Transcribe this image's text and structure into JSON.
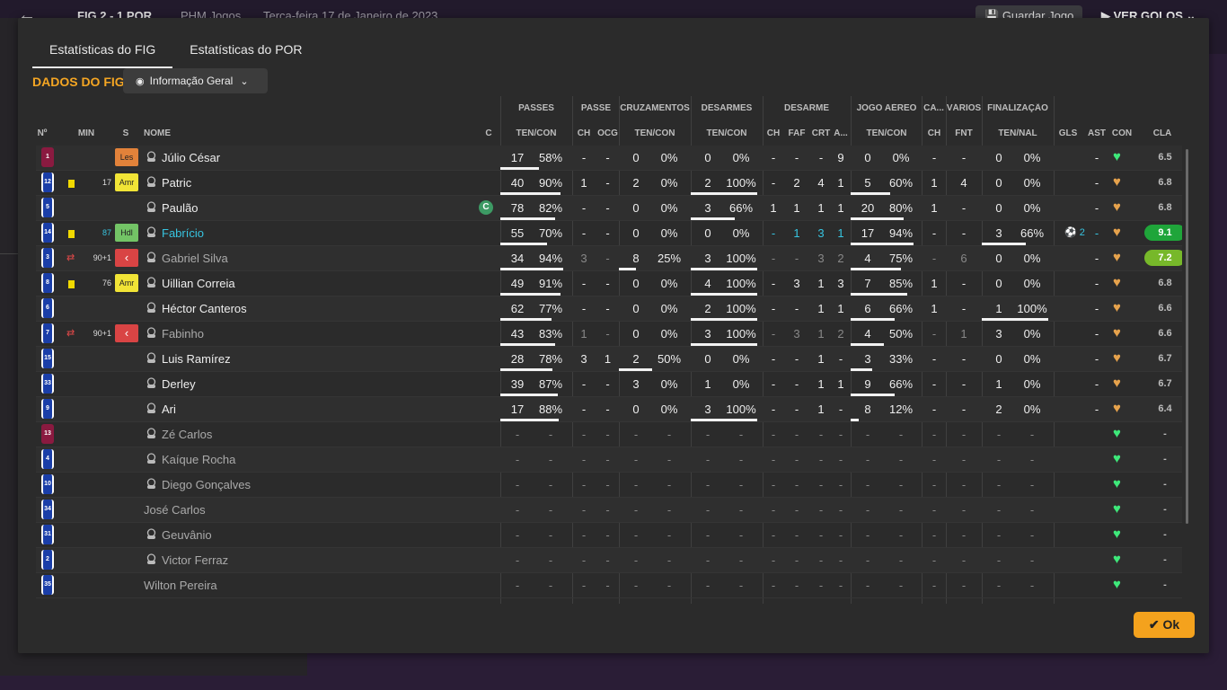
{
  "background": {
    "back_icon": "arrow-left-icon",
    "score": "FIG   2 - 1   POR",
    "venue": "PHM Jogos",
    "date": "Terça-feira 17 de Janeiro de 2023",
    "save_label": "Guardar Jogo",
    "goals_label": "VER GOLOS"
  },
  "tabs": [
    {
      "label": "Estatísticas do FIG",
      "active": true
    },
    {
      "label": "Estatísticas do POR",
      "active": false
    }
  ],
  "section_title": "DADOS DO FIG",
  "view_dropdown": {
    "label": "Informação Geral",
    "icon": "eye-icon"
  },
  "group_headers": [
    "PASSES",
    "PASSE",
    "CRUZAMENTOS",
    "DESARMES",
    "DESARME",
    "JOGO AÉREO",
    "CA...",
    "VÁRIOS",
    "FINALIZAÇÃO"
  ],
  "column_headers": [
    "Nº",
    "MIN",
    "S",
    "NOME",
    "C",
    "TEN/CON",
    "CH",
    "OCG",
    "TEN/CON",
    "TEN/CON",
    "CH",
    "FAF",
    "CRT",
    "A...",
    "TEN/CON",
    "CH",
    "FNT",
    "TEN/NAL",
    "GLS",
    "AST",
    "CON",
    "CLA"
  ],
  "colors": {
    "accent": "#f5a623",
    "cyan": "#37c4e0",
    "heart_green": "#3ee87a",
    "heart_orange": "#e6a24c",
    "rating_green": "#1fa53a",
    "rating_lime": "#77b82a"
  },
  "players": [
    {
      "num": "1",
      "kit": "gk",
      "card": false,
      "sub": false,
      "min": "",
      "min_cyan": false,
      "pos": "Les",
      "pos_type": "les",
      "icon": true,
      "name": "Júlio César",
      "name_style": "",
      "captain": false,
      "passes": [
        "17",
        "58%"
      ],
      "passes_pct": 58,
      "passe": [
        "-",
        "-"
      ],
      "cross": [
        "0",
        "0%"
      ],
      "cross_pct": 0,
      "tack": [
        "0",
        "0%"
      ],
      "tack_pct": 0,
      "des": [
        "-",
        "-",
        "-",
        "9"
      ],
      "air": [
        "0",
        "0%"
      ],
      "air_pct": 0,
      "ca": "-",
      "fnt": "-",
      "fin": [
        "0",
        "0%"
      ],
      "fin_pct": 0,
      "gls": "",
      "ast": "-",
      "heart": "g",
      "rating": "6.5",
      "rating_bg": "",
      "dim": false
    },
    {
      "num": "12",
      "kit": "bl",
      "card": true,
      "sub": false,
      "min": "17",
      "min_cyan": false,
      "pos": "Amr",
      "pos_type": "amr",
      "icon": true,
      "name": "Patric",
      "name_style": "",
      "captain": false,
      "passes": [
        "40",
        "90%"
      ],
      "passes_pct": 90,
      "passe": [
        "1",
        "-"
      ],
      "cross": [
        "2",
        "0%"
      ],
      "cross_pct": 0,
      "tack": [
        "2",
        "100%"
      ],
      "tack_pct": 100,
      "des": [
        "-",
        "2",
        "4",
        "1"
      ],
      "air": [
        "5",
        "60%"
      ],
      "air_pct": 60,
      "ca": "1",
      "fnt": "4",
      "fin": [
        "0",
        "0%"
      ],
      "fin_pct": 0,
      "gls": "",
      "ast": "-",
      "heart": "o",
      "rating": "6.8",
      "rating_bg": "",
      "dim": false
    },
    {
      "num": "5",
      "kit": "bl",
      "card": false,
      "sub": false,
      "min": "",
      "min_cyan": false,
      "pos": "",
      "pos_type": "",
      "icon": true,
      "name": "Paulão",
      "name_style": "",
      "captain": true,
      "passes": [
        "78",
        "82%"
      ],
      "passes_pct": 82,
      "passe": [
        "-",
        "-"
      ],
      "cross": [
        "0",
        "0%"
      ],
      "cross_pct": 0,
      "tack": [
        "3",
        "66%"
      ],
      "tack_pct": 66,
      "des": [
        "1",
        "1",
        "1",
        "1"
      ],
      "air": [
        "20",
        "80%"
      ],
      "air_pct": 80,
      "ca": "1",
      "fnt": "-",
      "fin": [
        "0",
        "0%"
      ],
      "fin_pct": 0,
      "gls": "",
      "ast": "-",
      "heart": "o",
      "rating": "6.8",
      "rating_bg": "",
      "dim": false
    },
    {
      "num": "14",
      "kit": "bl",
      "card": true,
      "sub": false,
      "min": "87",
      "min_cyan": true,
      "pos": "Hdl",
      "pos_type": "hdl",
      "icon": true,
      "name": "Fabrício",
      "name_style": "cy",
      "captain": false,
      "passes": [
        "55",
        "70%"
      ],
      "passes_pct": 70,
      "passe": [
        "-",
        "-"
      ],
      "cross": [
        "0",
        "0%"
      ],
      "cross_pct": 0,
      "tack": [
        "0",
        "0%"
      ],
      "tack_pct": 0,
      "des": [
        "-",
        "1",
        "3",
        "1"
      ],
      "des_cyan": true,
      "air": [
        "17",
        "94%"
      ],
      "air_pct": 94,
      "ca": "-",
      "fnt": "-",
      "fin": [
        "3",
        "66%"
      ],
      "fin_pct": 66,
      "gls": "2",
      "ast": "-",
      "heart": "o",
      "rating": "9.1",
      "rating_bg": "green",
      "dim": false
    },
    {
      "num": "3",
      "kit": "bl",
      "card": false,
      "sub": true,
      "min": "90+1",
      "min_cyan": false,
      "pos": "‹",
      "pos_type": "sub",
      "icon": true,
      "name": "Gabriel Silva",
      "name_style": "dim",
      "captain": false,
      "passes": [
        "34",
        "94%"
      ],
      "passes_pct": 94,
      "passe": [
        "3",
        "-"
      ],
      "cross": [
        "8",
        "25%"
      ],
      "cross_pct": 25,
      "tack": [
        "3",
        "100%"
      ],
      "tack_pct": 100,
      "des": [
        "-",
        "-",
        "3",
        "2"
      ],
      "air": [
        "4",
        "75%"
      ],
      "air_pct": 75,
      "ca": "-",
      "fnt": "6",
      "fin": [
        "0",
        "0%"
      ],
      "fin_pct": 0,
      "gls": "",
      "ast": "-",
      "heart": "o",
      "rating": "7.2",
      "rating_bg": "lime",
      "dim": true
    },
    {
      "num": "8",
      "kit": "bl",
      "card": true,
      "sub": false,
      "min": "76",
      "min_cyan": false,
      "pos": "Amr",
      "pos_type": "amr",
      "icon": true,
      "name": "Uillian Correia",
      "name_style": "",
      "captain": false,
      "passes": [
        "49",
        "91%"
      ],
      "passes_pct": 91,
      "passe": [
        "-",
        "-"
      ],
      "cross": [
        "0",
        "0%"
      ],
      "cross_pct": 0,
      "tack": [
        "4",
        "100%"
      ],
      "tack_pct": 100,
      "des": [
        "-",
        "3",
        "1",
        "3"
      ],
      "air": [
        "7",
        "85%"
      ],
      "air_pct": 85,
      "ca": "1",
      "fnt": "-",
      "fin": [
        "0",
        "0%"
      ],
      "fin_pct": 0,
      "gls": "",
      "ast": "-",
      "heart": "o",
      "rating": "6.8",
      "rating_bg": "",
      "dim": false
    },
    {
      "num": "6",
      "kit": "bl",
      "card": false,
      "sub": false,
      "min": "",
      "min_cyan": false,
      "pos": "",
      "pos_type": "",
      "icon": true,
      "name": "Héctor Canteros",
      "name_style": "",
      "captain": false,
      "passes": [
        "62",
        "77%"
      ],
      "passes_pct": 77,
      "passe": [
        "-",
        "-"
      ],
      "cross": [
        "0",
        "0%"
      ],
      "cross_pct": 0,
      "tack": [
        "2",
        "100%"
      ],
      "tack_pct": 100,
      "des": [
        "-",
        "-",
        "1",
        "1"
      ],
      "air": [
        "6",
        "66%"
      ],
      "air_pct": 66,
      "ca": "1",
      "fnt": "-",
      "fin": [
        "1",
        "100%"
      ],
      "fin_pct": 100,
      "gls": "",
      "ast": "-",
      "heart": "o",
      "rating": "6.6",
      "rating_bg": "",
      "dim": false
    },
    {
      "num": "7",
      "kit": "bl",
      "card": false,
      "sub": true,
      "min": "90+1",
      "min_cyan": false,
      "pos": "‹",
      "pos_type": "sub",
      "icon": true,
      "name": "Fabinho",
      "name_style": "dim",
      "captain": false,
      "passes": [
        "43",
        "83%"
      ],
      "passes_pct": 83,
      "passe": [
        "1",
        "-"
      ],
      "cross": [
        "0",
        "0%"
      ],
      "cross_pct": 0,
      "tack": [
        "3",
        "100%"
      ],
      "tack_pct": 100,
      "des": [
        "-",
        "3",
        "1",
        "2"
      ],
      "air": [
        "4",
        "50%"
      ],
      "air_pct": 50,
      "ca": "-",
      "fnt": "1",
      "fin": [
        "3",
        "0%"
      ],
      "fin_pct": 0,
      "gls": "",
      "ast": "-",
      "heart": "o",
      "rating": "6.6",
      "rating_bg": "",
      "dim": true
    },
    {
      "num": "15",
      "kit": "bl",
      "card": false,
      "sub": false,
      "min": "",
      "min_cyan": false,
      "pos": "",
      "pos_type": "",
      "icon": true,
      "name": "Luis Ramírez",
      "name_style": "",
      "captain": false,
      "passes": [
        "28",
        "78%"
      ],
      "passes_pct": 78,
      "passe": [
        "3",
        "1"
      ],
      "cross": [
        "2",
        "50%"
      ],
      "cross_pct": 50,
      "tack": [
        "0",
        "0%"
      ],
      "tack_pct": 0,
      "des": [
        "-",
        "-",
        "1",
        "-"
      ],
      "air": [
        "3",
        "33%"
      ],
      "air_pct": 33,
      "ca": "-",
      "fnt": "-",
      "fin": [
        "0",
        "0%"
      ],
      "fin_pct": 0,
      "gls": "",
      "ast": "-",
      "heart": "o",
      "rating": "6.7",
      "rating_bg": "",
      "dim": false
    },
    {
      "num": "33",
      "kit": "bl",
      "card": false,
      "sub": false,
      "min": "",
      "min_cyan": false,
      "pos": "",
      "pos_type": "",
      "icon": true,
      "name": "Derley",
      "name_style": "",
      "captain": false,
      "passes": [
        "39",
        "87%"
      ],
      "passes_pct": 87,
      "passe": [
        "-",
        "-"
      ],
      "cross": [
        "3",
        "0%"
      ],
      "cross_pct": 0,
      "tack": [
        "1",
        "0%"
      ],
      "tack_pct": 0,
      "des": [
        "-",
        "-",
        "1",
        "1"
      ],
      "air": [
        "9",
        "66%"
      ],
      "air_pct": 66,
      "ca": "-",
      "fnt": "-",
      "fin": [
        "1",
        "0%"
      ],
      "fin_pct": 0,
      "gls": "",
      "ast": "-",
      "heart": "o",
      "rating": "6.7",
      "rating_bg": "",
      "dim": false
    },
    {
      "num": "9",
      "kit": "bl",
      "card": false,
      "sub": false,
      "min": "",
      "min_cyan": false,
      "pos": "",
      "pos_type": "",
      "icon": true,
      "name": "Ari",
      "name_style": "",
      "captain": false,
      "passes": [
        "17",
        "88%"
      ],
      "passes_pct": 88,
      "passe": [
        "-",
        "-"
      ],
      "cross": [
        "0",
        "0%"
      ],
      "cross_pct": 0,
      "tack": [
        "3",
        "100%"
      ],
      "tack_pct": 100,
      "des": [
        "-",
        "-",
        "1",
        "-"
      ],
      "air": [
        "8",
        "12%"
      ],
      "air_pct": 12,
      "ca": "-",
      "fnt": "-",
      "fin": [
        "2",
        "0%"
      ],
      "fin_pct": 0,
      "gls": "",
      "ast": "-",
      "heart": "o",
      "rating": "6.4",
      "rating_bg": "",
      "dim": false
    },
    {
      "num": "13",
      "kit": "gk",
      "empty": true,
      "icon": true,
      "name": "Zé Carlos",
      "name_style": "dim",
      "heart": "g",
      "rating": "-"
    },
    {
      "num": "4",
      "kit": "bl",
      "empty": true,
      "icon": true,
      "name": "Kaíque Rocha",
      "name_style": "dim",
      "heart": "g",
      "rating": "-"
    },
    {
      "num": "10",
      "kit": "bl",
      "empty": true,
      "icon": true,
      "name": "Diego Gonçalves",
      "name_style": "dim",
      "heart": "g",
      "rating": "-"
    },
    {
      "num": "34",
      "kit": "bl",
      "empty": true,
      "icon": false,
      "name": "José Carlos",
      "name_style": "dim",
      "heart": "g",
      "rating": "-"
    },
    {
      "num": "31",
      "kit": "bl",
      "empty": true,
      "icon": true,
      "name": "Geuvânio",
      "name_style": "dim",
      "heart": "g",
      "rating": "-"
    },
    {
      "num": "2",
      "kit": "bl",
      "empty": true,
      "icon": true,
      "name": "Victor Ferraz",
      "name_style": "dim",
      "heart": "g",
      "rating": "-"
    },
    {
      "num": "35",
      "kit": "bl",
      "empty": true,
      "icon": false,
      "name": "Wilton Pereira",
      "name_style": "dim",
      "heart": "g",
      "rating": "-"
    }
  ],
  "ok_label": "Ok"
}
